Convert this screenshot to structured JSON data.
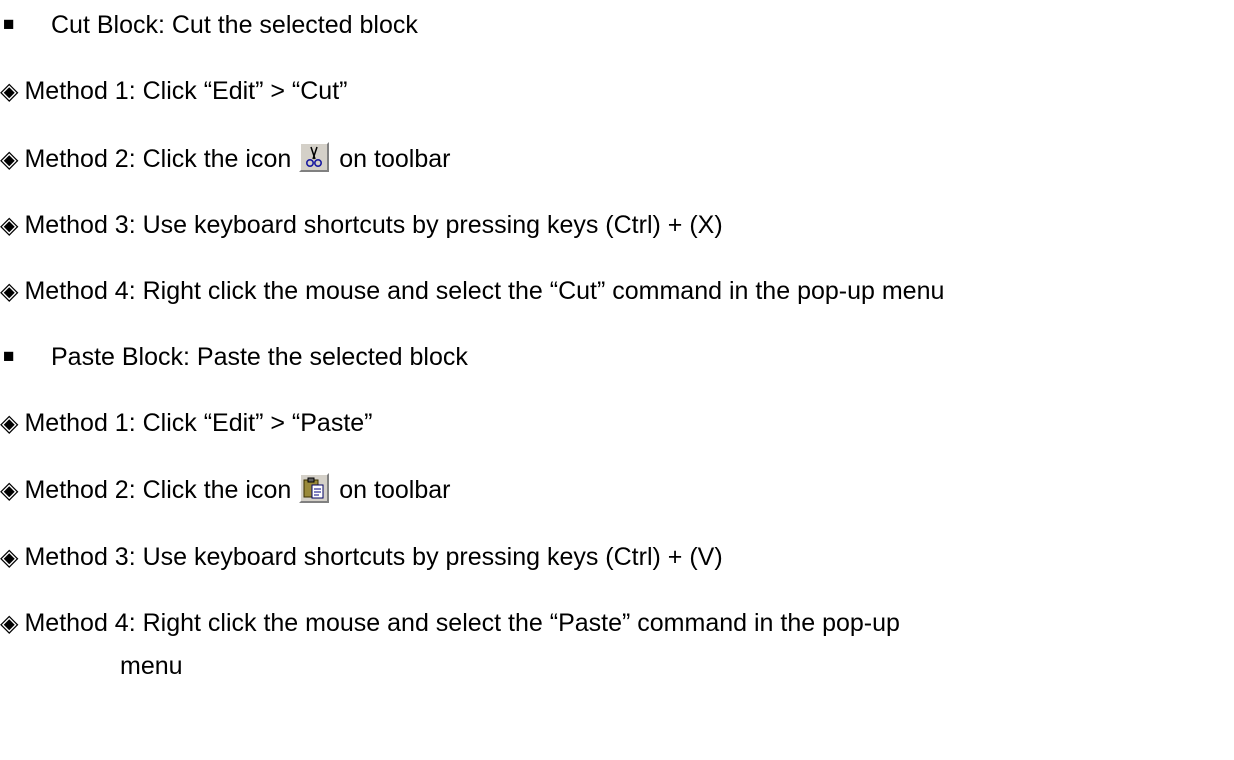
{
  "sections": [
    {
      "heading": "Cut Block: Cut the selected block",
      "methods": {
        "m1": "Method 1: Click “Edit” > “Cut”",
        "m2_before": "Method 2: Click the icon",
        "m2_after": "on toolbar",
        "m2_icon": "scissors-icon",
        "m3": "Method 3: Use keyboard shortcuts by pressing keys (Ctrl) + (X)",
        "m4": "Method 4: Right click the mouse and select the “Cut” command in the pop-up menu"
      }
    },
    {
      "heading": "Paste Block: Paste the selected block",
      "methods": {
        "m1": "Method 1: Click “Edit” > “Paste”",
        "m2_before": "Method 2: Click the icon",
        "m2_after": "on toolbar",
        "m2_icon": "clipboard-paste-icon",
        "m3": "Method 3: Use keyboard shortcuts by pressing keys (Ctrl) + (V)",
        "m4_line1": "Method 4: Right click the mouse and select the “Paste” command in the pop-up",
        "m4_line2": "menu"
      }
    }
  ],
  "bullets": {
    "square": "■",
    "diamond": "◈"
  }
}
